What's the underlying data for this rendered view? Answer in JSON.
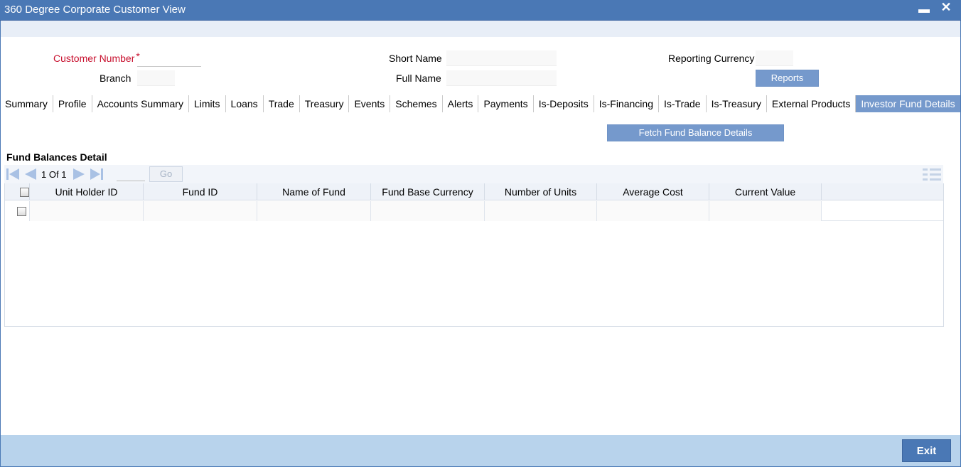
{
  "window": {
    "title": "360 Degree Corporate Customer View",
    "minimize_label": "▬",
    "close_label": "✕"
  },
  "form": {
    "customer_number_label": "Customer Number",
    "required_marker": "*",
    "branch_label": "Branch",
    "short_name_label": "Short Name",
    "full_name_label": "Full Name",
    "reporting_currency_label": "Reporting Currency",
    "reports_button": "Reports",
    "customer_number_value": "",
    "branch_value": "",
    "short_name_value": "",
    "full_name_value": "",
    "reporting_currency_value": ""
  },
  "tabs": [
    {
      "label": "Summary"
    },
    {
      "label": "Profile"
    },
    {
      "label": "Accounts Summary"
    },
    {
      "label": "Limits"
    },
    {
      "label": "Loans"
    },
    {
      "label": "Trade"
    },
    {
      "label": "Treasury"
    },
    {
      "label": "Events"
    },
    {
      "label": "Schemes"
    },
    {
      "label": "Alerts"
    },
    {
      "label": "Payments"
    },
    {
      "label": "Is-Deposits"
    },
    {
      "label": "Is-Financing"
    },
    {
      "label": "Is-Trade"
    },
    {
      "label": "Is-Treasury"
    },
    {
      "label": "External Products"
    },
    {
      "label": "Investor Fund Details",
      "active": true
    }
  ],
  "fetch_button": "Fetch Fund Balance Details",
  "section": {
    "title": "Fund Balances Detail"
  },
  "pager": {
    "current": "1",
    "of_label": "Of",
    "total": "1",
    "go_label": "Go"
  },
  "grid": {
    "columns": [
      "Unit Holder ID",
      "Fund ID",
      "Name of Fund",
      "Fund Base Currency",
      "Number of Units",
      "Average Cost",
      "Current Value"
    ]
  },
  "footer": {
    "exit_button": "Exit"
  },
  "colors": {
    "titlebar": "#4a78b5",
    "accent": "#7599cc",
    "required": "#c8102e",
    "footer": "#b8d3ec"
  }
}
